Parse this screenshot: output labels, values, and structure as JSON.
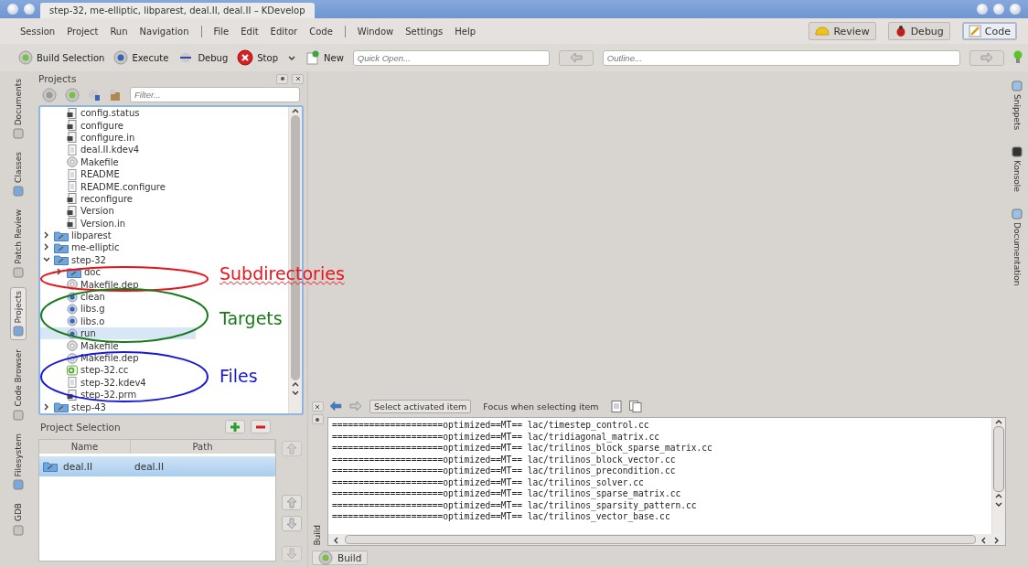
{
  "window": {
    "title": "step-32, me-elliptic, libparest, deal.II, deal.II – KDevelop"
  },
  "menu_groups": [
    [
      "Session",
      "Project",
      "Run",
      "Navigation"
    ],
    [
      "File",
      "Edit",
      "Editor",
      "Code"
    ],
    [
      "Window",
      "Settings",
      "Help"
    ]
  ],
  "perspectives": [
    {
      "label": "Review",
      "kind": "review",
      "selected": false
    },
    {
      "label": "Debug",
      "kind": "debug",
      "selected": false
    },
    {
      "label": "Code",
      "kind": "code",
      "selected": true
    }
  ],
  "toolbar": {
    "buttons": [
      {
        "label": "Build Selection",
        "kind": "build"
      },
      {
        "label": "Execute",
        "kind": "execute"
      },
      {
        "label": "Debug",
        "kind": "debug"
      },
      {
        "label": "Stop",
        "kind": "stop"
      }
    ],
    "new_label": "New",
    "quick_open": {
      "placeholder": "Quick Open..."
    },
    "outline": {
      "placeholder": "Outline..."
    }
  },
  "left_tabs": [
    {
      "label": "Documents",
      "selected": false
    },
    {
      "label": "Classes",
      "selected": false
    },
    {
      "label": "Patch Review",
      "selected": false
    },
    {
      "label": "Projects",
      "selected": true
    },
    {
      "label": "Code Browser",
      "selected": false
    },
    {
      "label": "Filesystem",
      "selected": false
    },
    {
      "label": "GDB",
      "selected": false
    }
  ],
  "right_tabs": [
    "Snippets",
    "Konsole",
    "Documentation"
  ],
  "projects_panel": {
    "title": "Projects",
    "filter": {
      "placeholder": "Filter..."
    },
    "tree": [
      {
        "children": [
          {
            "label": "config.status",
            "kind": "script",
            "selected": false
          },
          {
            "label": "configure",
            "kind": "script",
            "selected": false
          },
          {
            "label": "configure.in",
            "kind": "script",
            "selected": false
          },
          {
            "label": "deal.II.kdev4",
            "kind": "doc",
            "selected": false
          },
          {
            "label": "Makefile",
            "kind": "makefile",
            "selected": false
          },
          {
            "label": "README",
            "kind": "doc",
            "selected": false
          },
          {
            "label": "README.configure",
            "kind": "doc",
            "selected": false
          },
          {
            "label": "reconfigure",
            "kind": "script",
            "selected": false
          },
          {
            "label": "Version",
            "kind": "script",
            "selected": false
          },
          {
            "label": "Version.in",
            "kind": "script",
            "selected": false
          }
        ]
      },
      {
        "label": "libparest",
        "kind": "folder",
        "expanded": false,
        "selected": false
      },
      {
        "label": "me-elliptic",
        "kind": "folder",
        "expanded": false,
        "selected": false
      },
      {
        "label": "step-32",
        "kind": "folder",
        "expanded": true,
        "selected": false,
        "children": [
          {
            "label": "doc",
            "kind": "folder",
            "expanded": false,
            "selected": false
          },
          {
            "label": "Makefile.dep",
            "kind": "makefile",
            "selected": false
          },
          {
            "label": "clean",
            "kind": "target",
            "selected": false
          },
          {
            "label": "libs.g",
            "kind": "target",
            "selected": false
          },
          {
            "label": "libs.o",
            "kind": "target",
            "selected": false
          },
          {
            "label": "run",
            "kind": "target",
            "selected": true
          },
          {
            "label": "Makefile",
            "kind": "makefile",
            "selected": false
          },
          {
            "label": "Makefile.dep",
            "kind": "makefile",
            "selected": false
          },
          {
            "label": "step-32.cc",
            "kind": "cpp",
            "selected": false
          },
          {
            "label": "step-32.kdev4",
            "kind": "doc",
            "selected": false
          },
          {
            "label": "step-32.prm",
            "kind": "script",
            "selected": false
          }
        ]
      },
      {
        "label": "step-43",
        "kind": "folder",
        "expanded": false,
        "selected": false
      }
    ]
  },
  "annotations": [
    {
      "label": "Subdirectories",
      "color": "#e8141c"
    },
    {
      "label": "Targets",
      "color": "#1a7a1a"
    },
    {
      "label": "Files",
      "color": "#1818d8"
    }
  ],
  "project_selection": {
    "title": "Project Selection",
    "columns": [
      "Name",
      "Path"
    ],
    "rows": [
      {
        "name": "deal.II",
        "path": "deal.II",
        "selected": true
      }
    ]
  },
  "build_panel": {
    "label": "Build",
    "toggles": [
      {
        "label": "Select activated item",
        "on": true
      },
      {
        "label": "Focus when selecting item",
        "on": false
      }
    ],
    "lines": [
      "=====================optimized==MT== lac/timestep_control.cc",
      "=====================optimized==MT== lac/tridiagonal_matrix.cc",
      "=====================optimized==MT== lac/trilinos_block_sparse_matrix.cc",
      "=====================optimized==MT== lac/trilinos_block_vector.cc",
      "=====================optimized==MT== lac/trilinos_precondition.cc",
      "=====================optimized==MT== lac/trilinos_solver.cc",
      "=====================optimized==MT== lac/trilinos_sparse_matrix.cc",
      "=====================optimized==MT== lac/trilinos_sparsity_pattern.cc",
      "=====================optimized==MT== lac/trilinos_vector_base.cc"
    ]
  },
  "bottom_tabs": [
    "Build"
  ]
}
